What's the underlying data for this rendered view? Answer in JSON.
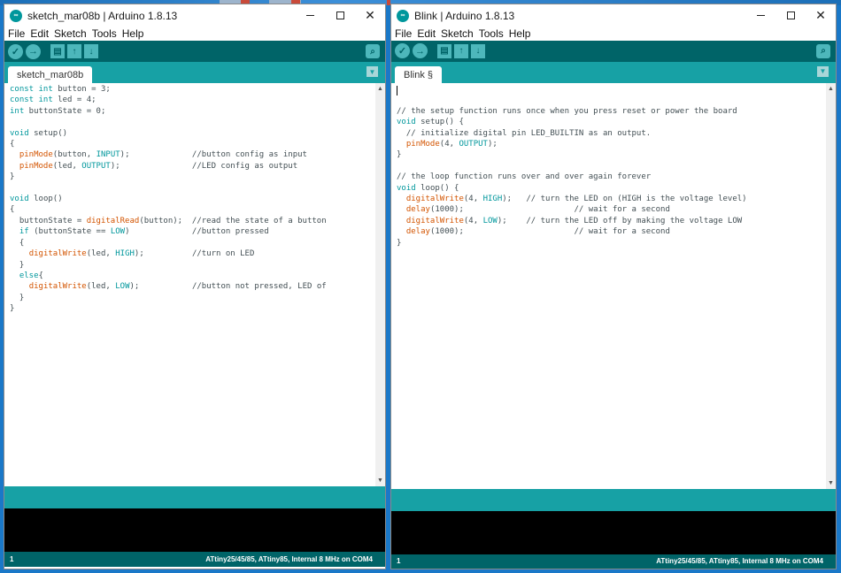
{
  "windows": [
    {
      "title": "sketch_mar08b | Arduino 1.8.13",
      "logo": "arduino-logo",
      "menu": [
        "File",
        "Edit",
        "Sketch",
        "Tools",
        "Help"
      ],
      "toolbar_icons": [
        "verify-icon",
        "upload-icon",
        "new-icon",
        "open-icon",
        "save-icon",
        "serial-monitor-icon"
      ],
      "tab": "sketch_mar08b",
      "code": [
        "const int button = 3;",
        "const int led = 4;",
        "int buttonState = 0;",
        "",
        "void setup()",
        "{",
        "  pinMode(button, INPUT);             //button config as input",
        "  pinMode(led, OUTPUT);               //LED config as output",
        "}",
        "",
        "void loop()",
        "{",
        "  buttonState = digitalRead(button);  //read the state of a button",
        "  if (buttonState == LOW)             //button pressed",
        "  {",
        "    digitalWrite(led, HIGH);          //turn on LED",
        "  }",
        "  else{",
        "    digitalWrite(led, LOW);           //button not pressed, LED of",
        "  }",
        "}"
      ],
      "status_line": "1",
      "board": "ATtiny25/45/85, ATtiny85, Internal 8 MHz on COM4"
    },
    {
      "title": "Blink | Arduino 1.8.13",
      "logo": "arduino-logo",
      "menu": [
        "File",
        "Edit",
        "Sketch",
        "Tools",
        "Help"
      ],
      "toolbar_icons": [
        "verify-icon",
        "upload-icon",
        "new-icon",
        "open-icon",
        "save-icon",
        "serial-monitor-icon"
      ],
      "tab": "Blink §",
      "code": [
        "",
        "",
        "// the setup function runs once when you press reset or power the board",
        "void setup() {",
        "  // initialize digital pin LED_BUILTIN as an output.",
        "  pinMode(4, OUTPUT);",
        "}",
        "",
        "// the loop function runs over and over again forever",
        "void loop() {",
        "  digitalWrite(4, HIGH);   // turn the LED on (HIGH is the voltage level)",
        "  delay(1000);                       // wait for a second",
        "  digitalWrite(4, LOW);    // turn the LED off by making the voltage LOW",
        "  delay(1000);                       // wait for a second",
        "}"
      ],
      "status_line": "1",
      "board": "ATtiny25/45/85, ATtiny85, Internal 8 MHz on COM4"
    }
  ],
  "colors": {
    "arduino_teal_dark": "#006468",
    "arduino_teal": "#17a1a5",
    "keyword": "#00979c",
    "function": "#d35400",
    "desktop": "#1a78c8"
  }
}
